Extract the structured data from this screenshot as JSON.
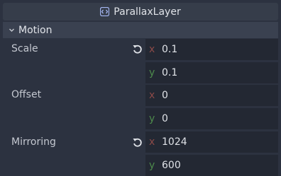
{
  "header": {
    "title": "ParallaxLayer",
    "icon": "parallax-layer-icon"
  },
  "section": {
    "title": "Motion",
    "icon": "chevron-down-icon"
  },
  "properties": [
    {
      "label": "Scale",
      "has_revert": true,
      "x_axis": "x",
      "y_axis": "y",
      "x": "0.1",
      "y": "0.1"
    },
    {
      "label": "Offset",
      "has_revert": false,
      "x_axis": "x",
      "y_axis": "y",
      "x": "0",
      "y": "0"
    },
    {
      "label": "Mirroring",
      "has_revert": true,
      "x_axis": "x",
      "y_axis": "y",
      "x": "1024",
      "y": "600"
    }
  ],
  "colors": {
    "background": "#2c3240",
    "field": "#232833",
    "axis_x": "#8c4a48",
    "axis_y": "#4d8a4c"
  }
}
